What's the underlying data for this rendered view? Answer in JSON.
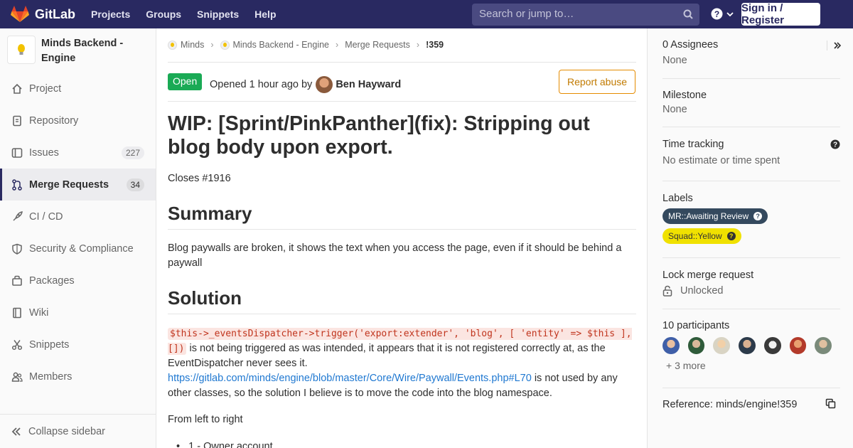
{
  "navbar": {
    "brand": "GitLab",
    "links": [
      "Projects",
      "Groups",
      "Snippets",
      "Help"
    ],
    "search_placeholder": "Search or jump to…",
    "signin": "Sign in / Register"
  },
  "sidebar": {
    "project_name": "Minds Backend - Engine",
    "items": [
      {
        "label": "Project",
        "icon": "home-icon"
      },
      {
        "label": "Repository",
        "icon": "doc-icon"
      },
      {
        "label": "Issues",
        "icon": "issues-icon",
        "count": "227"
      },
      {
        "label": "Merge Requests",
        "icon": "merge-request-icon",
        "count": "34",
        "active": true
      },
      {
        "label": "CI / CD",
        "icon": "rocket-icon"
      },
      {
        "label": "Security & Compliance",
        "icon": "shield-icon"
      },
      {
        "label": "Packages",
        "icon": "package-icon"
      },
      {
        "label": "Wiki",
        "icon": "book-icon"
      },
      {
        "label": "Snippets",
        "icon": "scissors-icon"
      },
      {
        "label": "Members",
        "icon": "users-icon"
      }
    ],
    "collapse": "Collapse sidebar"
  },
  "breadcrumb": [
    "Minds",
    "Minds Backend - Engine",
    "Merge Requests",
    "!359"
  ],
  "mr": {
    "status": "Open",
    "opened": "Opened 1 hour ago by",
    "author": "Ben Hayward",
    "report": "Report abuse",
    "title": "WIP: [Sprint/PinkPanther](fix): Stripping out blog body upon export.",
    "closes": "Closes #1916",
    "summary_heading": "Summary",
    "summary_text": "Blog paywalls are broken, it shows the text when you access the page, even if it should be behind a paywall",
    "solution_heading": "Solution",
    "solution_code": "$this->_eventsDispatcher->trigger('export:extender', 'blog', [ 'entity' => $this ], [])",
    "solution_text1": " is not being triggered as was intended, it appears that it is not registered correctly at, as the EventDispatcher never sees it.",
    "solution_link": "https://gitlab.com/minds/engine/blob/master/Core/Wire/Paywall/Events.php#L70",
    "solution_text2": " is not used by any other classes, so the solution I believe is to move the code into the blog namespace.",
    "from_left": "From left to right",
    "list_item1": "1 - Owner account"
  },
  "right": {
    "assignees_title": "0 Assignees",
    "assignees_value": "None",
    "milestone_title": "Milestone",
    "milestone_value": "None",
    "time_title": "Time tracking",
    "time_value": "No estimate or time spent",
    "labels_title": "Labels",
    "label1": "MR::Awaiting Review",
    "label2": "Squad::Yellow",
    "lock_title": "Lock merge request",
    "lock_value": "Unlocked",
    "participants_title": "10 participants",
    "participants_more": "+ 3 more",
    "reference": "Reference: minds/engine!359"
  },
  "colors": {
    "navbar": "#292961",
    "open_badge": "#1aaa55",
    "report_border": "#e58b00",
    "label1": "#34495e",
    "label2": "#f0e100",
    "link": "#1f78d1"
  }
}
